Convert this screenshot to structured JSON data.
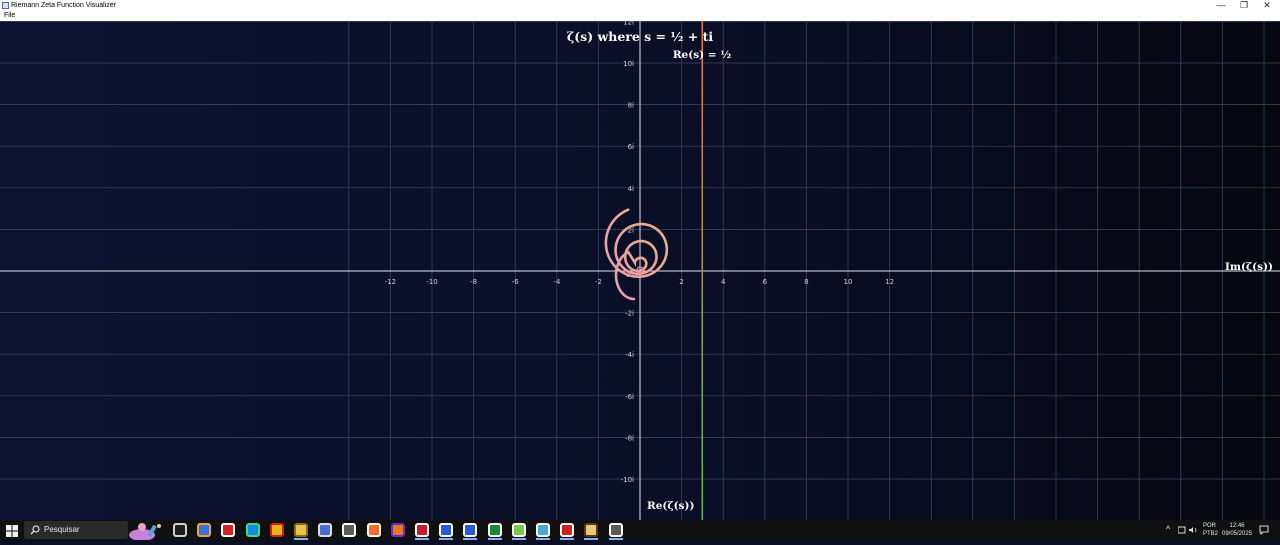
{
  "window": {
    "title": "Riemann Zeta Function Visualizer",
    "controls": {
      "minimize": "—",
      "restore": "❐",
      "close": "✕"
    }
  },
  "menu": {
    "items": [
      "File"
    ]
  },
  "plot": {
    "title": "ζ(s) where s = ½ + ti",
    "critical_line_label": "Re(s) = ½",
    "horizontal_axis_label": "Im(ζ(s))",
    "vertical_axis_label": "Re(ζ(s))",
    "x_ticks": [
      "-12",
      "-10",
      "-8",
      "-6",
      "-4",
      "-2",
      "0",
      "2",
      "4",
      "6",
      "8",
      "10",
      "12"
    ],
    "y_ticks": [
      "12i",
      "10i",
      "8i",
      "6i",
      "4i",
      "2i",
      "-2i",
      "-4i",
      "-6i",
      "-8i",
      "-10i"
    ],
    "colors": {
      "critical_line_top": "#e8782a",
      "critical_line_bottom": "#58b848",
      "curve_start": "#e89ab8",
      "curve_end": "#e8b27a",
      "axis": "#dfe3ee",
      "grid": "#3c4868"
    }
  },
  "taskbar": {
    "search_placeholder": "Pesquisar",
    "apps": [
      "Task View",
      "Copilot",
      "Opera",
      "Edge",
      "Chrome",
      "File Explorer",
      "Chromium",
      "Chrome (alt)",
      "Brave",
      "Firefox",
      "Ruby",
      "Azure Data Studio",
      "Word",
      "Excel",
      "Notepad++",
      "Notepad",
      "Acrobat",
      "Pen Tool",
      "Calculator"
    ],
    "tray": {
      "language_top": "POR",
      "language_bottom": "PTB2",
      "time": "12:46",
      "date": "09/05/2025"
    }
  }
}
